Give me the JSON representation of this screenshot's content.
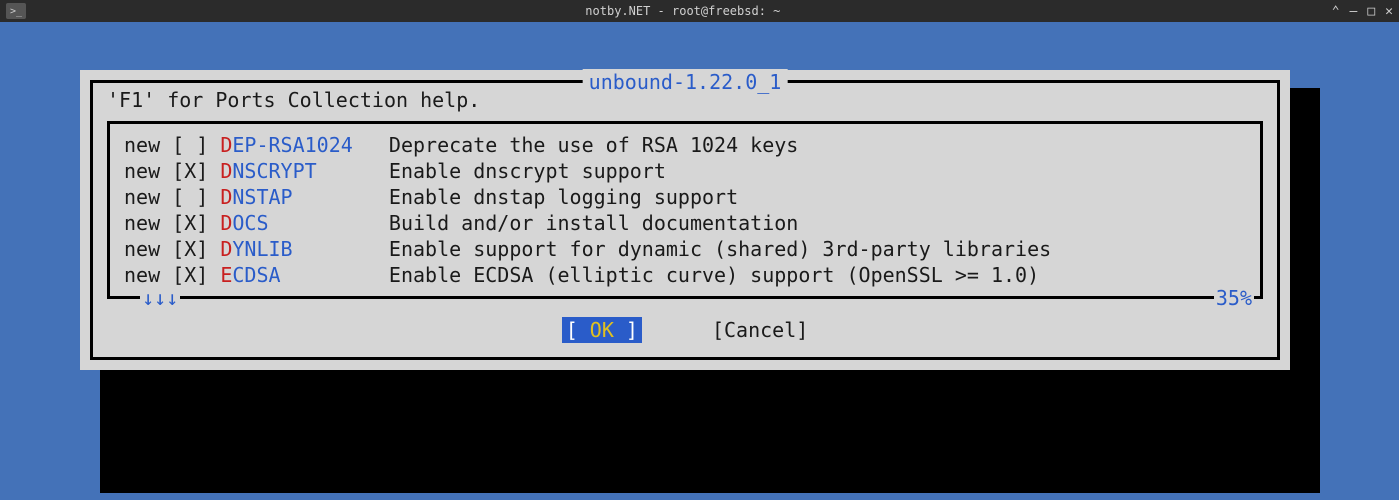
{
  "window": {
    "title": "notby.NET - root@freebsd: ~",
    "controls": {
      "up": "⌃",
      "min": "—",
      "max": "□",
      "close": "✕"
    },
    "icon_glyph": ">_"
  },
  "dialog": {
    "title": " unbound-1.22.0_1 ",
    "help_text": "'F1' for Ports Collection help.",
    "scroll_indicator": "↓↓↓",
    "percent": "35%",
    "options": [
      {
        "prefix": "new [ ] ",
        "hotkey": "D",
        "name": "EP-RSA1024",
        "pad": "   ",
        "desc": "Deprecate the use of RSA 1024 keys"
      },
      {
        "prefix": "new [X] ",
        "hotkey": "D",
        "name": "NSCRYPT",
        "pad": "      ",
        "desc": "Enable dnscrypt support"
      },
      {
        "prefix": "new [ ] ",
        "hotkey": "D",
        "name": "NSTAP",
        "pad": "        ",
        "desc": "Enable dnstap logging support"
      },
      {
        "prefix": "new [X] ",
        "hotkey": "D",
        "name": "OCS",
        "pad": "          ",
        "desc": "Build and/or install documentation"
      },
      {
        "prefix": "new [X] ",
        "hotkey": "D",
        "name": "YNLIB",
        "pad": "        ",
        "desc": "Enable support for dynamic (shared) 3rd-party libraries"
      },
      {
        "prefix": "new [X] ",
        "hotkey": "E",
        "name": "CDSA",
        "pad": "         ",
        "desc": "Enable ECDSA (elliptic curve) support (OpenSSL >= 1.0)"
      }
    ],
    "buttons": {
      "ok_l": "[  ",
      "ok_label": "OK",
      "ok_r": "  ]",
      "cancel": "[Cancel]"
    }
  }
}
